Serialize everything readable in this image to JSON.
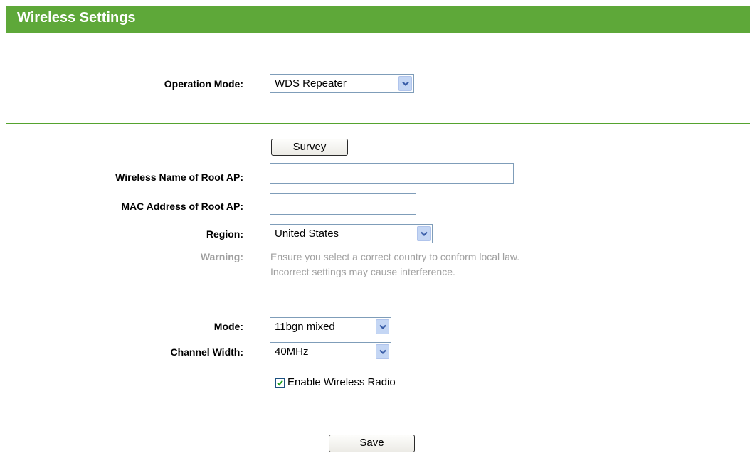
{
  "page": {
    "title": "Wireless Settings"
  },
  "operation_mode": {
    "label": "Operation Mode:",
    "value": "WDS Repeater"
  },
  "survey_button": "Survey",
  "root_ap": {
    "name_label": "Wireless Name of Root AP:",
    "name_value": "",
    "mac_label": "MAC Address of Root AP:",
    "mac_value": ""
  },
  "region": {
    "label": "Region:",
    "value": "United States"
  },
  "warning": {
    "label": "Warning:",
    "line1": "Ensure you select a correct country to conform local law.",
    "line2": "Incorrect settings may cause interference."
  },
  "mode": {
    "label": "Mode:",
    "value": "11bgn mixed"
  },
  "channel_width": {
    "label": "Channel Width:",
    "value": "40MHz"
  },
  "wireless_radio": {
    "label": "Enable Wireless Radio",
    "checked": true
  },
  "save_button": "Save",
  "colors": {
    "header": "#5ea839",
    "divider": "#55a32e",
    "warning_text": "#a0a0a0"
  },
  "icons": {
    "dropdown": "chevron-down-icon",
    "checkbox": "checkmark-icon"
  }
}
